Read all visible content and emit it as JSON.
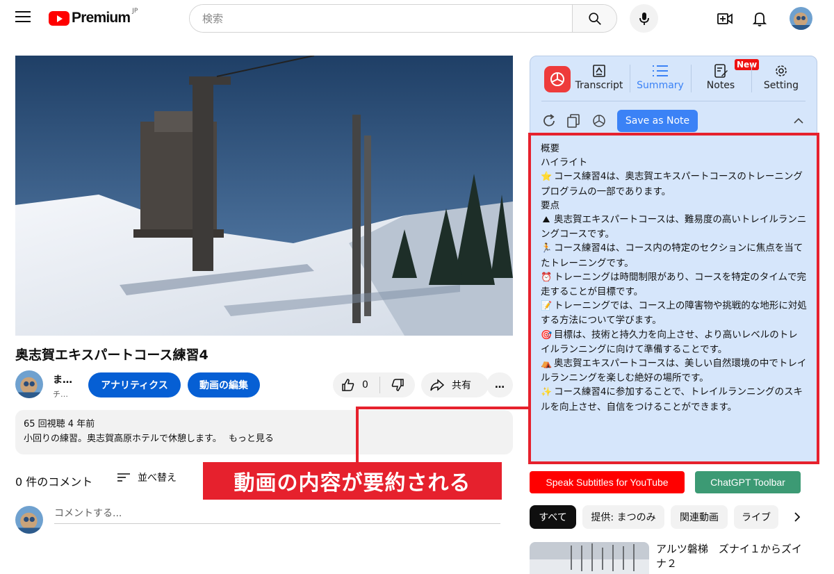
{
  "header": {
    "logo_text": "Premium",
    "logo_region": "JP",
    "search_placeholder": "検索"
  },
  "video": {
    "title": "奥志賀エキスパートコース練習4",
    "channel_name": "ま…",
    "channel_subs": "チ…",
    "analytics_label": "アナリティクス",
    "edit_label": "動画の編集",
    "like_count": "0",
    "share_label": "共有",
    "more_label": "…"
  },
  "description": {
    "stats": "65 回視聴  4 年前",
    "text": "小回りの練習。奥志賀高原ホテルで休憩します。",
    "more": "もっと見る"
  },
  "comments": {
    "count_label": "0 件のコメント",
    "sort_label": "並べ替え",
    "placeholder": "コメントする..."
  },
  "callout": {
    "text": "動画の内容が要約される"
  },
  "extension": {
    "tabs": [
      {
        "label": "Transcript",
        "icon": "transcript-icon"
      },
      {
        "label": "Summary",
        "icon": "list-icon"
      },
      {
        "label": "Notes",
        "icon": "notes-icon"
      },
      {
        "label": "Setting",
        "icon": "gear-icon"
      }
    ],
    "new_badge": "New",
    "save_note_label": "Save as Note",
    "accent_color": "#3b82f6",
    "summary": {
      "heading": "概要",
      "highlight_title": "ハイライト",
      "highlight": "コース練習4は、奥志賀エキスパートコースのトレーニングプログラムの一部であります。",
      "points_title": "要点",
      "points": [
        {
          "icon": "mountain-icon",
          "glyph": "⛰",
          "text": "奥志賀エキスパートコースは、難易度の高いトレイルランニングコースです。"
        },
        {
          "icon": "runner-icon",
          "glyph": "🏃",
          "text": "コース練習4は、コース内の特定のセクションに焦点を当てたトレーニングです。"
        },
        {
          "icon": "alarm-clock-icon",
          "glyph": "⏰",
          "text": "トレーニングは時間制限があり、コースを特定のタイムで完走することが目標です。"
        },
        {
          "icon": "memo-icon",
          "glyph": "📝",
          "text": "トレーニングでは、コース上の障害物や挑戦的な地形に対処する方法について学びます。"
        },
        {
          "icon": "target-icon",
          "glyph": "🎯",
          "text": "目標は、技術と持久力を向上させ、より高いレベルのトレイルランニングに向けて準備することです。"
        },
        {
          "icon": "camping-icon",
          "glyph": "⛺",
          "text": "奥志賀エキスパートコースは、美しい自然環境の中でトレイルランニングを楽しむ絶好の場所です。"
        },
        {
          "icon": "sparkle-icon",
          "glyph": "✨",
          "text": "コース練習4に参加することで、トレイルランニングのスキルを向上させ、自信をつけることができます。"
        }
      ]
    }
  },
  "sidebar": {
    "speak_subtitles_label": "Speak Subtitles for YouTube",
    "chatgpt_toolbar_label": "ChatGPT Toolbar",
    "chips": [
      "すべて",
      "提供: まつのみ",
      "関連動画",
      "ライブ"
    ],
    "recommended_title": "アルツ磐梯　ズナイ１からズイナ２"
  }
}
